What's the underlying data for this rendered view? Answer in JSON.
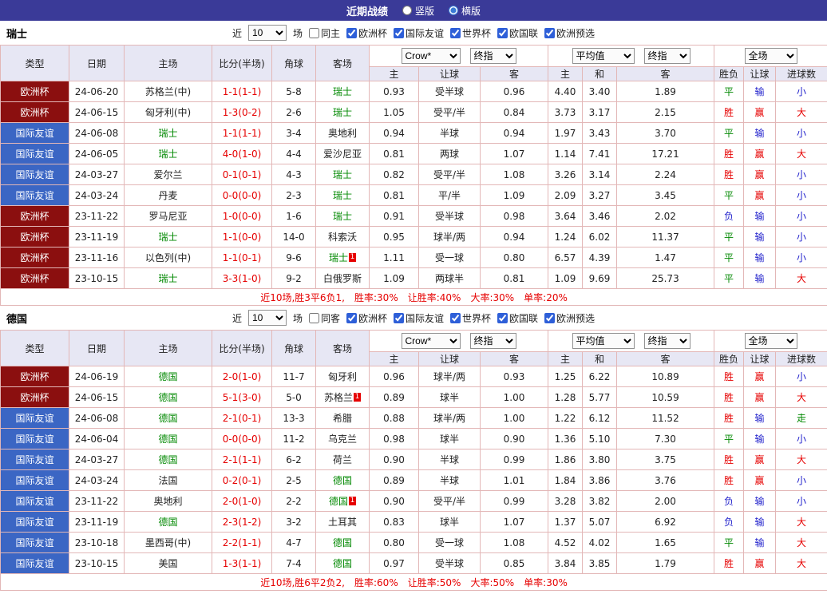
{
  "topbar": {
    "title": "近期战绩",
    "options": [
      {
        "label": "竖版",
        "selected": false
      },
      {
        "label": "横版",
        "selected": true
      }
    ]
  },
  "table_headers": {
    "type": "类型",
    "date": "日期",
    "home": "主场",
    "score": "比分(半场)",
    "corner": "角球",
    "away": "客场",
    "asia_selects": [
      "Crow*",
      "终指"
    ],
    "euro_selects": [
      "平均值",
      "终指"
    ],
    "scope_select": "全场",
    "sub_headers": [
      "主",
      "让球",
      "客",
      "主",
      "和",
      "客",
      "胜负",
      "让球",
      "进球数"
    ]
  },
  "colors": {
    "topbar_bg": "#3a3a98",
    "header_bg": "#e7e7f4",
    "border": "#e3b7b7",
    "type_badge": {
      "欧洲杯": "#8b0f0f",
      "国际友谊": "#3b66c4"
    },
    "result": {
      "胜": "#e60000",
      "赢": "#e60000",
      "大": "#e60000",
      "平": "#008800",
      "走": "#008800",
      "负": "#2222cc",
      "输": "#2222cc",
      "小": "#2222cc"
    }
  },
  "sections": [
    {
      "team": "瑞士",
      "filter": {
        "near_label": "近",
        "count": "10",
        "matches_label": "场",
        "same_venue": {
          "label": "同主",
          "checked": false
        },
        "competitions": [
          {
            "label": "欧洲杯",
            "checked": true
          },
          {
            "label": "国际友谊",
            "checked": true
          },
          {
            "label": "世界杯",
            "checked": true
          },
          {
            "label": "欧国联",
            "checked": true
          },
          {
            "label": "欧洲预选",
            "checked": true
          }
        ]
      },
      "rows": [
        {
          "type": "欧洲杯",
          "date": "24-06-20",
          "home": "苏格兰(中)",
          "home_self": false,
          "score": "1-1(1-1)",
          "corner": "5-8",
          "away": "瑞士",
          "away_self": true,
          "asia": [
            "0.93",
            "受半球",
            "0.96"
          ],
          "euro": [
            "4.40",
            "3.40",
            "1.89"
          ],
          "results": [
            "平",
            "输",
            "小"
          ]
        },
        {
          "type": "欧洲杯",
          "date": "24-06-15",
          "home": "匈牙利(中)",
          "home_self": false,
          "score": "1-3(0-2)",
          "corner": "2-6",
          "away": "瑞士",
          "away_self": true,
          "asia": [
            "1.05",
            "受平/半",
            "0.84"
          ],
          "euro": [
            "3.73",
            "3.17",
            "2.15"
          ],
          "results": [
            "胜",
            "赢",
            "大"
          ]
        },
        {
          "type": "国际友谊",
          "date": "24-06-08",
          "home": "瑞士",
          "home_self": true,
          "score": "1-1(1-1)",
          "corner": "3-4",
          "away": "奥地利",
          "away_self": false,
          "asia": [
            "0.94",
            "半球",
            "0.94"
          ],
          "euro": [
            "1.97",
            "3.43",
            "3.70"
          ],
          "results": [
            "平",
            "输",
            "小"
          ]
        },
        {
          "type": "国际友谊",
          "date": "24-06-05",
          "home": "瑞士",
          "home_self": true,
          "score": "4-0(1-0)",
          "corner": "4-4",
          "away": "爱沙尼亚",
          "away_self": false,
          "asia": [
            "0.81",
            "两球",
            "1.07"
          ],
          "euro": [
            "1.14",
            "7.41",
            "17.21"
          ],
          "results": [
            "胜",
            "赢",
            "大"
          ]
        },
        {
          "type": "国际友谊",
          "date": "24-03-27",
          "home": "爱尔兰",
          "home_self": false,
          "score": "0-1(0-1)",
          "corner": "4-3",
          "away": "瑞士",
          "away_self": true,
          "asia": [
            "0.82",
            "受平/半",
            "1.08"
          ],
          "euro": [
            "3.26",
            "3.14",
            "2.24"
          ],
          "results": [
            "胜",
            "赢",
            "小"
          ]
        },
        {
          "type": "国际友谊",
          "date": "24-03-24",
          "home": "丹麦",
          "home_self": false,
          "score": "0-0(0-0)",
          "corner": "2-3",
          "away": "瑞士",
          "away_self": true,
          "asia": [
            "0.81",
            "平/半",
            "1.09"
          ],
          "euro": [
            "2.09",
            "3.27",
            "3.45"
          ],
          "results": [
            "平",
            "赢",
            "小"
          ]
        },
        {
          "type": "欧洲杯",
          "date": "23-11-22",
          "home": "罗马尼亚",
          "home_self": false,
          "score": "1-0(0-0)",
          "corner": "1-6",
          "away": "瑞士",
          "away_self": true,
          "asia": [
            "0.91",
            "受半球",
            "0.98"
          ],
          "euro": [
            "3.64",
            "3.46",
            "2.02"
          ],
          "results": [
            "负",
            "输",
            "小"
          ]
        },
        {
          "type": "欧洲杯",
          "date": "23-11-19",
          "home": "瑞士",
          "home_self": true,
          "score": "1-1(0-0)",
          "corner": "14-0",
          "away": "科索沃",
          "away_self": false,
          "asia": [
            "0.95",
            "球半/两",
            "0.94"
          ],
          "euro": [
            "1.24",
            "6.02",
            "11.37"
          ],
          "results": [
            "平",
            "输",
            "小"
          ]
        },
        {
          "type": "欧洲杯",
          "date": "23-11-16",
          "home": "以色列(中)",
          "home_self": false,
          "score": "1-1(0-1)",
          "corner": "9-6",
          "away": "瑞士",
          "away_self": true,
          "away_card": "1",
          "asia": [
            "1.11",
            "受一球",
            "0.80"
          ],
          "euro": [
            "6.57",
            "4.39",
            "1.47"
          ],
          "results": [
            "平",
            "输",
            "小"
          ]
        },
        {
          "type": "欧洲杯",
          "date": "23-10-15",
          "home": "瑞士",
          "home_self": true,
          "score": "3-3(1-0)",
          "corner": "9-2",
          "away": "白俄罗斯",
          "away_self": false,
          "asia": [
            "1.09",
            "两球半",
            "0.81"
          ],
          "euro": [
            "1.09",
            "9.69",
            "25.73"
          ],
          "results": [
            "平",
            "输",
            "大"
          ]
        }
      ],
      "footer": {
        "prefix": "近10场,胜3平6负1,",
        "stats": [
          "胜率:30%",
          "让胜率:40%",
          "大率:30%",
          "单率:20%"
        ]
      }
    },
    {
      "team": "德国",
      "filter": {
        "near_label": "近",
        "count": "10",
        "matches_label": "场",
        "same_venue": {
          "label": "同客",
          "checked": false
        },
        "competitions": [
          {
            "label": "欧洲杯",
            "checked": true
          },
          {
            "label": "国际友谊",
            "checked": true
          },
          {
            "label": "世界杯",
            "checked": true
          },
          {
            "label": "欧国联",
            "checked": true
          },
          {
            "label": "欧洲预选",
            "checked": true
          }
        ]
      },
      "rows": [
        {
          "type": "欧洲杯",
          "date": "24-06-19",
          "home": "德国",
          "home_self": true,
          "score": "2-0(1-0)",
          "corner": "11-7",
          "away": "匈牙利",
          "away_self": false,
          "asia": [
            "0.96",
            "球半/两",
            "0.93"
          ],
          "euro": [
            "1.25",
            "6.22",
            "10.89"
          ],
          "results": [
            "胜",
            "赢",
            "小"
          ]
        },
        {
          "type": "欧洲杯",
          "date": "24-06-15",
          "home": "德国",
          "home_self": true,
          "score": "5-1(3-0)",
          "corner": "5-0",
          "away": "苏格兰",
          "away_self": false,
          "away_card": "1",
          "asia": [
            "0.89",
            "球半",
            "1.00"
          ],
          "euro": [
            "1.28",
            "5.77",
            "10.59"
          ],
          "results": [
            "胜",
            "赢",
            "大"
          ]
        },
        {
          "type": "国际友谊",
          "date": "24-06-08",
          "home": "德国",
          "home_self": true,
          "score": "2-1(0-1)",
          "corner": "13-3",
          "away": "希腊",
          "away_self": false,
          "asia": [
            "0.88",
            "球半/两",
            "1.00"
          ],
          "euro": [
            "1.22",
            "6.12",
            "11.52"
          ],
          "results": [
            "胜",
            "输",
            "走"
          ]
        },
        {
          "type": "国际友谊",
          "date": "24-06-04",
          "home": "德国",
          "home_self": true,
          "score": "0-0(0-0)",
          "corner": "11-2",
          "away": "乌克兰",
          "away_self": false,
          "asia": [
            "0.98",
            "球半",
            "0.90"
          ],
          "euro": [
            "1.36",
            "5.10",
            "7.30"
          ],
          "results": [
            "平",
            "输",
            "小"
          ]
        },
        {
          "type": "国际友谊",
          "date": "24-03-27",
          "home": "德国",
          "home_self": true,
          "score": "2-1(1-1)",
          "corner": "6-2",
          "away": "荷兰",
          "away_self": false,
          "asia": [
            "0.90",
            "半球",
            "0.99"
          ],
          "euro": [
            "1.86",
            "3.80",
            "3.75"
          ],
          "results": [
            "胜",
            "赢",
            "大"
          ]
        },
        {
          "type": "国际友谊",
          "date": "24-03-24",
          "home": "法国",
          "home_self": false,
          "score": "0-2(0-1)",
          "corner": "2-5",
          "away": "德国",
          "away_self": true,
          "asia": [
            "0.89",
            "半球",
            "1.01"
          ],
          "euro": [
            "1.84",
            "3.86",
            "3.76"
          ],
          "results": [
            "胜",
            "赢",
            "小"
          ]
        },
        {
          "type": "国际友谊",
          "date": "23-11-22",
          "home": "奥地利",
          "home_self": false,
          "score": "2-0(1-0)",
          "corner": "2-2",
          "away": "德国",
          "away_self": true,
          "away_card": "1",
          "asia": [
            "0.90",
            "受平/半",
            "0.99"
          ],
          "euro": [
            "3.28",
            "3.82",
            "2.00"
          ],
          "results": [
            "负",
            "输",
            "小"
          ]
        },
        {
          "type": "国际友谊",
          "date": "23-11-19",
          "home": "德国",
          "home_self": true,
          "score": "2-3(1-2)",
          "corner": "3-2",
          "away": "土耳其",
          "away_self": false,
          "asia": [
            "0.83",
            "球半",
            "1.07"
          ],
          "euro": [
            "1.37",
            "5.07",
            "6.92"
          ],
          "results": [
            "负",
            "输",
            "大"
          ]
        },
        {
          "type": "国际友谊",
          "date": "23-10-18",
          "home": "墨西哥(中)",
          "home_self": false,
          "score": "2-2(1-1)",
          "corner": "4-7",
          "away": "德国",
          "away_self": true,
          "asia": [
            "0.80",
            "受一球",
            "1.08"
          ],
          "euro": [
            "4.52",
            "4.02",
            "1.65"
          ],
          "results": [
            "平",
            "输",
            "大"
          ]
        },
        {
          "type": "国际友谊",
          "date": "23-10-15",
          "home": "美国",
          "home_self": false,
          "score": "1-3(1-1)",
          "corner": "7-4",
          "away": "德国",
          "away_self": true,
          "asia": [
            "0.97",
            "受半球",
            "0.85"
          ],
          "euro": [
            "3.84",
            "3.85",
            "1.79"
          ],
          "results": [
            "胜",
            "赢",
            "大"
          ]
        }
      ],
      "footer": {
        "prefix": "近10场,胜6平2负2,",
        "stats": [
          "胜率:60%",
          "让胜率:50%",
          "大率:50%",
          "单率:30%"
        ]
      }
    }
  ]
}
